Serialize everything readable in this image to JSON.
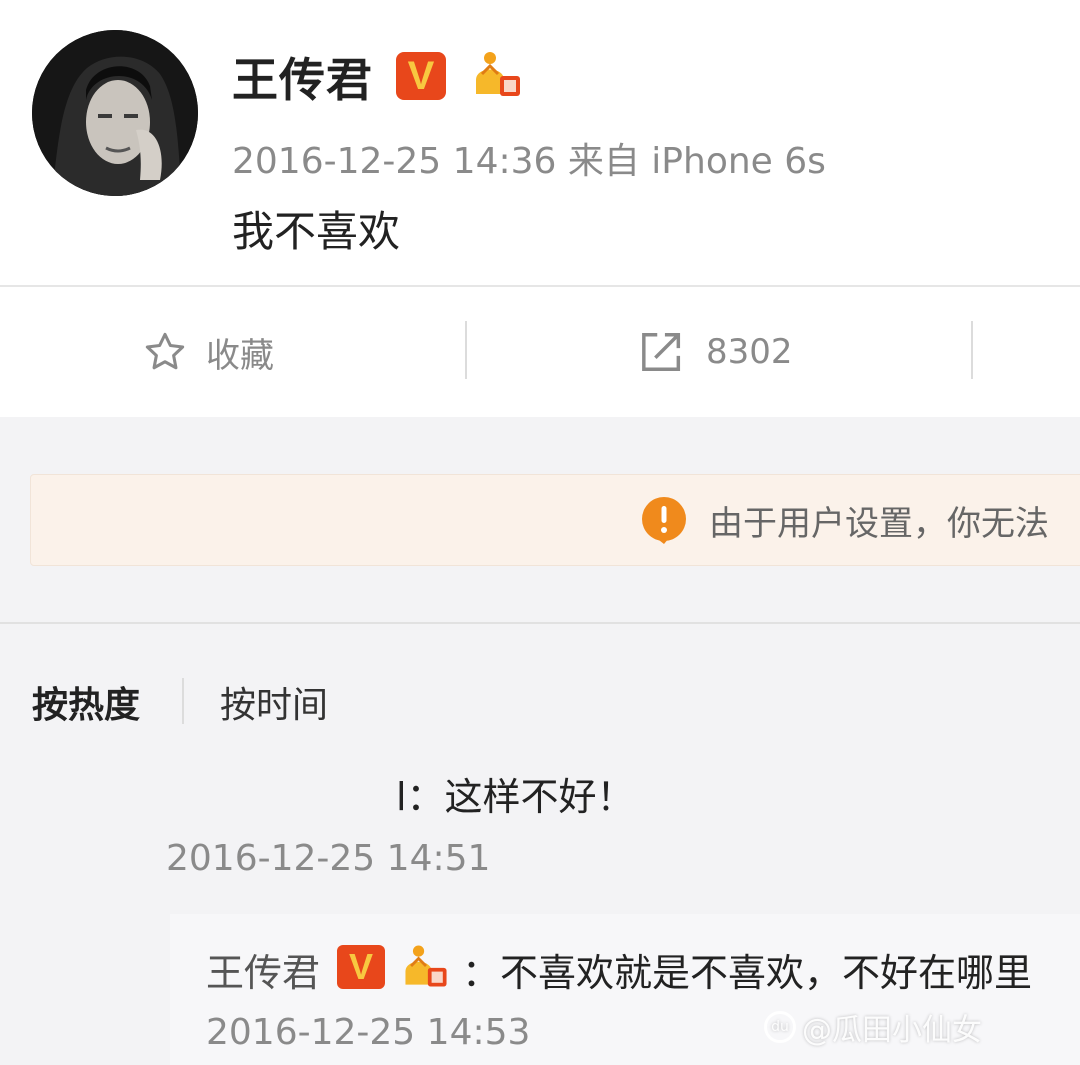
{
  "post": {
    "username": "王传君",
    "verified_badge": "V",
    "member_icon": "vip-crown-icon",
    "meta": "2016-12-25 14:36 来自 iPhone 6s",
    "text": "我不喜欢"
  },
  "actions": {
    "favorite_label": "收藏",
    "favorite_icon": "star-outline-icon",
    "share_count": "8302",
    "share_icon": "share-arrow-icon"
  },
  "notice": {
    "icon": "warning-icon",
    "text": "由于用户设置，你无法"
  },
  "sort": {
    "hot_label": "按热度",
    "time_label": "按时间"
  },
  "comments": [
    {
      "text": "l：这样不好！",
      "time": "2016-12-25 14:51",
      "reply": {
        "username": "王传君",
        "verified_badge": "V",
        "text": "：不喜欢就是不喜欢，不好在哪里",
        "time": "2016-12-25 14:53"
      }
    }
  ],
  "watermark": {
    "text": "@瓜田小仙女"
  },
  "colors": {
    "badge_red": "#e8471b",
    "notice_bg": "#fbf2ea",
    "warning_orange": "#f08a1c"
  }
}
